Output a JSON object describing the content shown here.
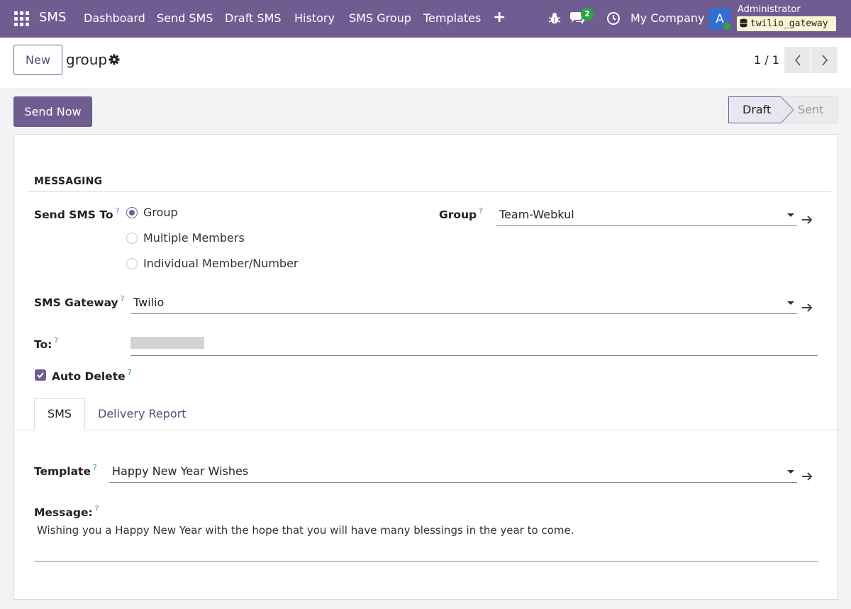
{
  "navbar": {
    "app_name": "SMS",
    "menu": [
      "Dashboard",
      "Send SMS",
      "Draft SMS",
      "History",
      "SMS Group",
      "Templates"
    ],
    "plus": "+",
    "messages_count": "2",
    "company": "My Company",
    "avatar_letter": "A",
    "user_name": "Administrator",
    "database": "twilio_gateway",
    "bg_color": "#6f5d91"
  },
  "control": {
    "new_label": "New",
    "breadcrumb": "group",
    "pager": "1 / 1"
  },
  "statusbar": {
    "send_label": "Send Now",
    "stages": [
      "Draft",
      "Sent"
    ],
    "current_stage": "Draft"
  },
  "form": {
    "section_title": "MESSAGING",
    "send_sms_to_label": "Send SMS To",
    "send_options": [
      "Group",
      "Multiple Members",
      "Individual Member/Number"
    ],
    "selected_option": "Group",
    "group_label": "Group",
    "group_value": "Team-Webkul",
    "gateway_label": "SMS Gateway",
    "gateway_value": "Twilio",
    "to_label": "To:",
    "auto_delete_label": "Auto Delete",
    "auto_delete_checked": true,
    "help_mark": "?",
    "tabs": [
      "SMS",
      "Delivery Report"
    ],
    "active_tab": "SMS",
    "template_label": "Template",
    "template_value": "Happy New Year Wishes",
    "message_label": "Message:",
    "message_value": "Wishing you a Happy New Year with the hope that you will have many blessings in the year to come."
  }
}
